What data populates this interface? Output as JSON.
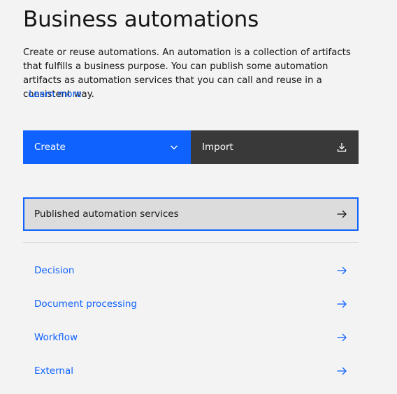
{
  "page": {
    "title": "Business automations",
    "description": "Create or reuse automations. An automation is a collection of artifacts that fulfills a business purpose. You can publish some automation artifacts as automation services that you can call and reuse in a consistent way.",
    "learn_more": "Learn more"
  },
  "actions": {
    "create_label": "Create",
    "import_label": "Import"
  },
  "published": {
    "label": "Published automation services"
  },
  "links": [
    {
      "label": "Decision"
    },
    {
      "label": "Document processing"
    },
    {
      "label": "Workflow"
    },
    {
      "label": "External"
    }
  ],
  "colors": {
    "accent": "#0f62fe",
    "dark_button": "#393939",
    "background": "#f3f3f3",
    "tile_selected": "#dcdcdc"
  },
  "icons": {
    "create": "chevron-down-icon",
    "import": "download-icon",
    "tile_arrow": "arrow-right-icon"
  }
}
